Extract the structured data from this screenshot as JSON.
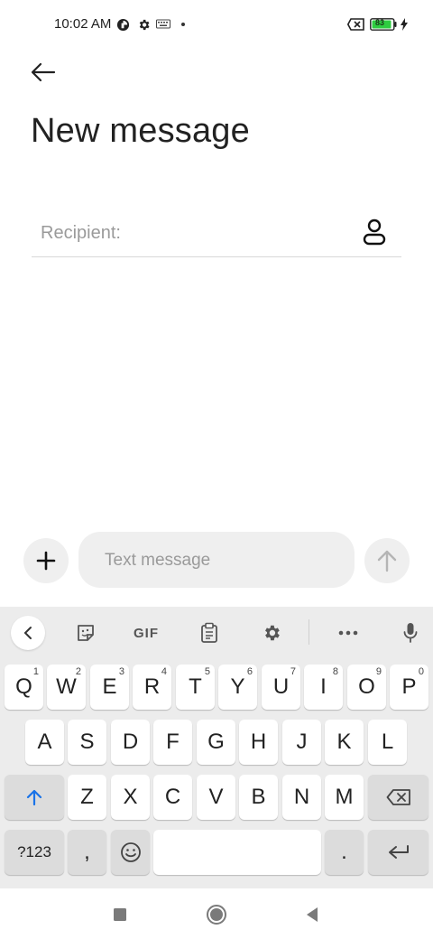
{
  "status_bar": {
    "time": "10:02 AM",
    "battery": "83"
  },
  "header": {
    "title": "New message"
  },
  "recipient": {
    "placeholder": "Recipient:"
  },
  "compose": {
    "placeholder": "Text message"
  },
  "keyboard_toolbar": {
    "gif_label": "GIF"
  },
  "keyboard": {
    "row1": [
      {
        "label": "Q",
        "hint": "1"
      },
      {
        "label": "W",
        "hint": "2"
      },
      {
        "label": "E",
        "hint": "3"
      },
      {
        "label": "R",
        "hint": "4"
      },
      {
        "label": "T",
        "hint": "5"
      },
      {
        "label": "Y",
        "hint": "6"
      },
      {
        "label": "U",
        "hint": "7"
      },
      {
        "label": "I",
        "hint": "8"
      },
      {
        "label": "O",
        "hint": "9"
      },
      {
        "label": "P",
        "hint": "0"
      }
    ],
    "row2": [
      "A",
      "S",
      "D",
      "F",
      "G",
      "H",
      "J",
      "K",
      "L"
    ],
    "row3": [
      "Z",
      "X",
      "C",
      "V",
      "B",
      "N",
      "M"
    ],
    "symbols_label": "?123",
    "comma_label": ",",
    "period_label": "."
  },
  "colors": {
    "accent": "#1a73e8",
    "keyboard_bg": "#ececec",
    "compose_bg": "#efefef",
    "battery_green": "#2ecc40"
  }
}
